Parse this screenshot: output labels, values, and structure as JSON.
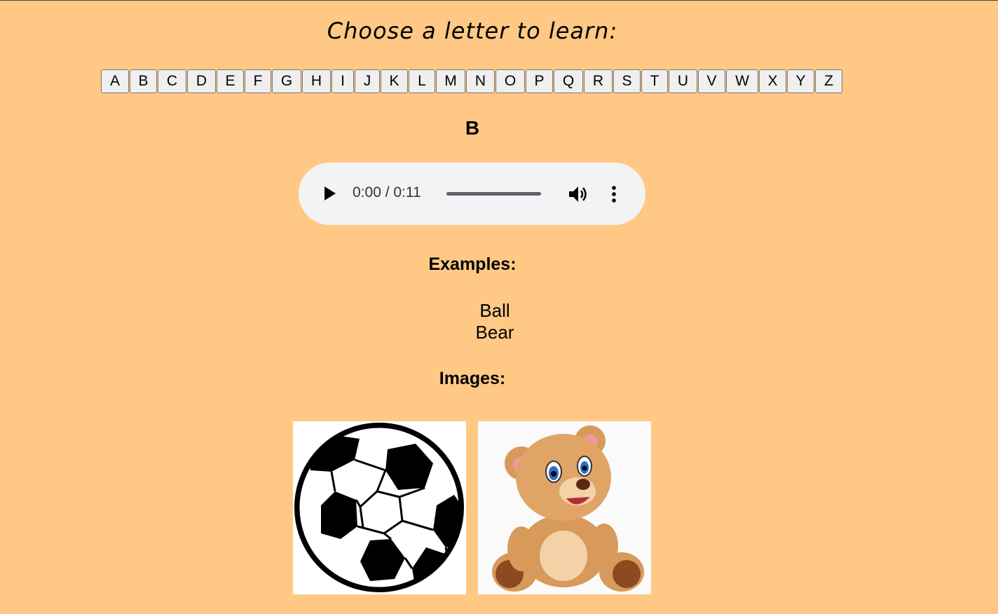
{
  "page": {
    "title": "Choose a letter to learn:",
    "selected_letter": "B"
  },
  "letters": [
    "A",
    "B",
    "C",
    "D",
    "E",
    "F",
    "G",
    "H",
    "I",
    "J",
    "K",
    "L",
    "M",
    "N",
    "O",
    "P",
    "Q",
    "R",
    "S",
    "T",
    "U",
    "V",
    "W",
    "X",
    "Y",
    "Z"
  ],
  "audio": {
    "time_display": "0:00 / 0:11",
    "play_icon": "play-icon",
    "volume_icon": "volume-icon",
    "more_icon": "more-options-icon"
  },
  "examples": {
    "heading": "Examples:",
    "items": [
      "Ball",
      "Bear"
    ]
  },
  "images": {
    "heading": "Images:",
    "items": [
      {
        "subject": "soccer ball"
      },
      {
        "subject": "teddy bear"
      }
    ]
  },
  "colors": {
    "background": "#ffc985",
    "player_background": "#f1f3f4",
    "button_background": "#efefef"
  }
}
